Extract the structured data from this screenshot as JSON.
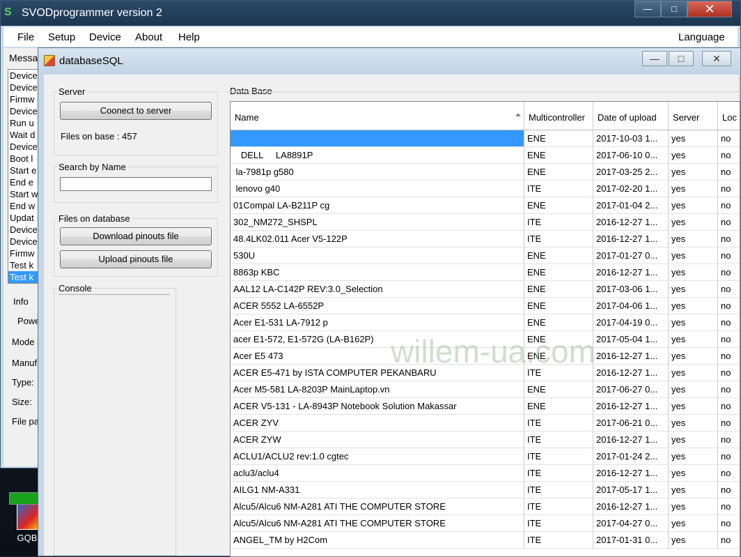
{
  "main_window": {
    "title": "SVODprogrammer version 2",
    "menu": [
      "File",
      "Setup",
      "Device",
      "About",
      "Help"
    ],
    "language": "Language",
    "messages_label": "Messa",
    "messages": [
      "Device",
      "Device",
      "Firmw",
      "Device",
      "Run u",
      "Wait d",
      "Device",
      "Boot l",
      "Start e",
      "End e",
      "Start w",
      "End w",
      "Updat",
      "Device",
      "Device",
      "Firmw",
      "Test k",
      "Test k"
    ],
    "info": {
      "info": "Info",
      "power": "Powe",
      "mode": "Mode",
      "manuf": "Manuf",
      "type": "Type:",
      "size": "Size:",
      "file": "File pa"
    }
  },
  "desktop_icon": "GQBla",
  "dialog": {
    "title": "databaseSQL",
    "server": {
      "title": "Server",
      "connect_button": "Coonect to server",
      "files_on_base": "Files on base : 457"
    },
    "search": {
      "title": "Search by Name",
      "value": ""
    },
    "files": {
      "title": "Files on database",
      "download_button": "Download pinouts file",
      "upload_button": "Upload pinouts file"
    },
    "console": {
      "title": "Console"
    },
    "database": {
      "title": "Data Base",
      "columns": [
        "Name",
        "Multicontroller",
        "Date of upload",
        "Server",
        "Loc"
      ],
      "rows": [
        [
          "",
          "ENE",
          "2017-10-03 1...",
          "yes",
          "no"
        ],
        [
          "   DELL     LA8891P",
          "ENE",
          "2017-06-10 0...",
          "yes",
          "no"
        ],
        [
          " la-7981p g580",
          "ENE",
          "2017-03-25 2...",
          "yes",
          "no"
        ],
        [
          " lenovo g40",
          "ITE",
          "2017-02-20 1...",
          "yes",
          "no"
        ],
        [
          "01Compal LA-B211P cg",
          "ENE",
          "2017-01-04 2...",
          "yes",
          "no"
        ],
        [
          "302_NM272_SHSPL",
          "ITE",
          "2016-12-27 1...",
          "yes",
          "no"
        ],
        [
          "48.4LK02.011 Acer V5-122P",
          "ITE",
          "2016-12-27 1...",
          "yes",
          "no"
        ],
        [
          "530U",
          "ENE",
          "2017-01-27 0...",
          "yes",
          "no"
        ],
        [
          "8863p KBC",
          "ENE",
          "2016-12-27 1...",
          "yes",
          "no"
        ],
        [
          "AAL12 LA-C142P REV:3.0_Selection",
          "ENE",
          "2017-03-06 1...",
          "yes",
          "no"
        ],
        [
          "ACER 5552 LA-6552P",
          "ENE",
          "2017-04-06 1...",
          "yes",
          "no"
        ],
        [
          "Acer E1-531 LA-7912 p",
          "ENE",
          "2017-04-19 0...",
          "yes",
          "no"
        ],
        [
          "acer E1-572, E1-572G (LA-B162P)",
          "ENE",
          "2017-05-04 1...",
          "yes",
          "no"
        ],
        [
          "Acer E5 473",
          "ENE",
          "2016-12-27 1...",
          "yes",
          "no"
        ],
        [
          "ACER E5-471 by ISTA COMPUTER PEKANBARU",
          "ITE",
          "2016-12-27 1...",
          "yes",
          "no"
        ],
        [
          "Acer M5-581 LA-8203P MainLaptop.vn",
          "ENE",
          "2017-06-27 0...",
          "yes",
          "no"
        ],
        [
          "ACER V5-131 - LA-8943P Notebook Solution Makassar",
          "ENE",
          "2016-12-27 1...",
          "yes",
          "no"
        ],
        [
          "ACER ZYV",
          "ITE",
          "2017-06-21 0...",
          "yes",
          "no"
        ],
        [
          "ACER ZYW",
          "ITE",
          "2016-12-27 1...",
          "yes",
          "no"
        ],
        [
          "ACLU1/ACLU2 rev:1.0 cgtec",
          "ITE",
          "2017-01-24 2...",
          "yes",
          "no"
        ],
        [
          "aclu3/aclu4",
          "ITE",
          "2016-12-27 1...",
          "yes",
          "no"
        ],
        [
          "AILG1 NM-A331",
          "ITE",
          "2017-05-17 1...",
          "yes",
          "no"
        ],
        [
          "Alcu5/Alcu6 NM-A281 ATI THE COMPUTER STORE",
          "ITE",
          "2016-12-27 1...",
          "yes",
          "no"
        ],
        [
          "Alcu5/Alcu6 NM-A281 ATI THE COMPUTER STORE",
          "ITE",
          "2017-04-27 0...",
          "yes",
          "no"
        ],
        [
          "ANGEL_TM by H2Com",
          "ITE",
          "2017-01-31 0...",
          "yes",
          "no"
        ]
      ]
    }
  },
  "watermark": "willem-ua.com",
  "colors": {
    "selection": "#3399ff",
    "progress": "#19a21d"
  }
}
